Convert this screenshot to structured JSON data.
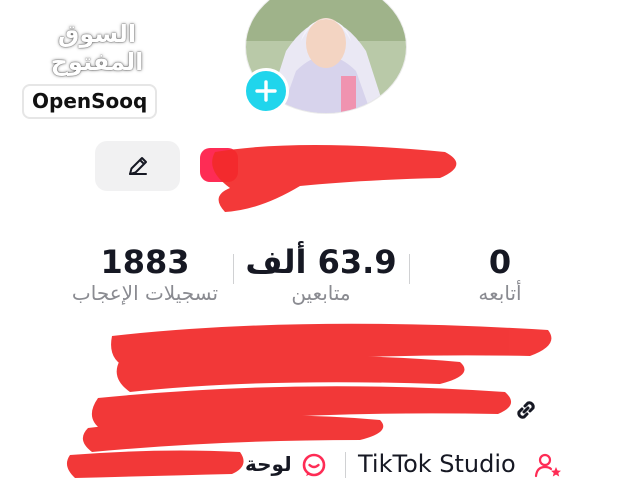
{
  "watermark": {
    "arabic": "السوق المفتوح",
    "latin": "OpenSooq"
  },
  "stats": [
    {
      "value": "1883",
      "label": "تسجيلات الإعجاب"
    },
    {
      "value": "63.9 ألف",
      "label": "متابعين"
    },
    {
      "value": "0",
      "label": "أتابعه"
    }
  ],
  "bottom_bar": {
    "studio_label": "TikTok Studio",
    "dashboard_label": "لوحة"
  },
  "colors": {
    "accent_cyan": "#20d5ec",
    "tiktok_red": "#fe2c55",
    "redaction_red": "#f22a2a",
    "muted_text": "#8a8b91"
  },
  "icons": [
    "pencil-icon",
    "plus-icon",
    "link-icon",
    "users-star-icon",
    "chat-bubble-icon"
  ]
}
